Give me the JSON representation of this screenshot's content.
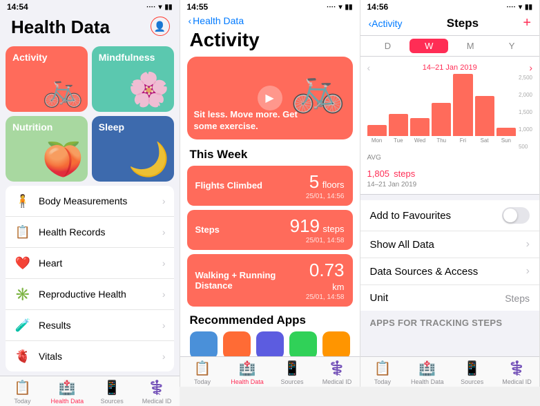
{
  "panel1": {
    "status_time": "14:54",
    "title": "Health Data",
    "tiles": [
      {
        "id": "activity",
        "label": "Activity",
        "color": "#ff6b5b"
      },
      {
        "id": "mindfulness",
        "label": "Mindfulness",
        "color": "#5bc8af"
      },
      {
        "id": "nutrition",
        "label": "Nutrition",
        "color": "#a8d8a0"
      },
      {
        "id": "sleep",
        "label": "Sleep",
        "color": "#3d6aad"
      }
    ],
    "list_items": [
      {
        "icon": "🧍",
        "label": "Body Measurements"
      },
      {
        "icon": "📋",
        "label": "Health Records"
      },
      {
        "icon": "❤️",
        "label": "Heart"
      },
      {
        "icon": "✳️",
        "label": "Reproductive Health"
      },
      {
        "icon": "🧪",
        "label": "Results"
      },
      {
        "icon": "🫀",
        "label": "Vitals"
      }
    ],
    "tabs": [
      {
        "label": "Today",
        "icon": "📋",
        "active": false
      },
      {
        "label": "Health Data",
        "icon": "🏥",
        "active": true
      },
      {
        "label": "Sources",
        "icon": "📱",
        "active": false
      },
      {
        "label": "Medical ID",
        "icon": "⚕️",
        "active": false
      }
    ]
  },
  "panel2": {
    "status_time": "14:55",
    "nav_back": "Health Data",
    "title": "Activity",
    "promo_text": "Sit less. Move more. Get\nsome exercise.",
    "this_week_label": "This Week",
    "stats": [
      {
        "label": "Flights Climbed",
        "value": "5",
        "unit": "floors",
        "date": "25/01, 14:56"
      },
      {
        "label": "Steps",
        "value": "919",
        "unit": "steps",
        "date": "25/01, 14:58"
      },
      {
        "label": "Walking + Running Distance",
        "value": "0.73",
        "unit": "km",
        "date": "25/01, 14:58"
      }
    ],
    "rec_label": "Recommended Apps",
    "tabs": [
      {
        "label": "Today",
        "active": false
      },
      {
        "label": "Health Data",
        "active": true
      },
      {
        "label": "Sources",
        "active": false
      },
      {
        "label": "Medical ID",
        "active": false
      }
    ]
  },
  "panel3": {
    "status_time": "14:56",
    "nav_back": "Activity",
    "title": "Steps",
    "add_label": "+",
    "period_buttons": [
      "D",
      "W",
      "M",
      "Y"
    ],
    "active_period": "W",
    "chart_date": "14–21 Jan 2019",
    "chart_days": [
      "Mon",
      "Tue",
      "Wed",
      "Thu",
      "Fri",
      "Sat",
      "Sun"
    ],
    "chart_bars": [
      400,
      800,
      650,
      1200,
      2500,
      1500,
      300
    ],
    "chart_max": 2500,
    "y_labels": [
      "2,500",
      "2,000",
      "1,500",
      "1,000",
      "500",
      ""
    ],
    "avg_label": "AVG",
    "avg_value": "1,805",
    "avg_unit": "steps",
    "avg_date": "14–21 Jan 2019",
    "settings": [
      {
        "label": "Add to Favourites",
        "type": "toggle",
        "value": false
      },
      {
        "label": "Show All Data",
        "type": "nav",
        "value": ""
      },
      {
        "label": "Data Sources & Access",
        "type": "nav",
        "value": ""
      },
      {
        "label": "Unit",
        "type": "value",
        "value": "Steps"
      }
    ],
    "apps_tracking_label": "Apps for Tracking Steps",
    "tabs": [
      {
        "label": "Today",
        "active": false
      },
      {
        "label": "Health Data",
        "active": false
      },
      {
        "label": "Sources",
        "active": false
      },
      {
        "label": "Medical ID",
        "active": false
      }
    ]
  }
}
